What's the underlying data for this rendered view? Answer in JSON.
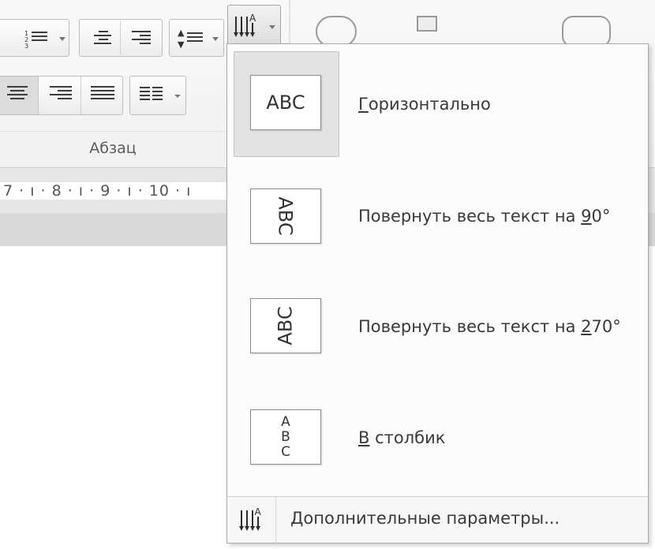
{
  "ribbon": {
    "group_label": "Абзац"
  },
  "ruler": {
    "text": "7 · ı · 8 · ı · 9 · ı · 10 · ı"
  },
  "menu": {
    "items": [
      {
        "label_underlined": "Г",
        "label_rest": "оризонтально",
        "thumb": "ABC",
        "selected": true
      },
      {
        "label_before": "Повернуть весь текст на ",
        "label_underlined": "9",
        "label_after": "0°",
        "thumb": "ABC"
      },
      {
        "label_before": "Повернуть весь текст на ",
        "label_underlined": "2",
        "label_after": "70°",
        "thumb": "ABC"
      },
      {
        "label_underlined": "В",
        "label_rest": " столбик",
        "thumb_letters": [
          "A",
          "B",
          "C"
        ]
      }
    ],
    "footer": {
      "label_underlined": "Д",
      "label_rest": "ополнительные параметры..."
    }
  },
  "icons": {
    "text_direction": "text-direction-icon",
    "numbered_list": "numbered-list-icon",
    "decrease_indent": "decrease-indent-icon",
    "increase_indent": "increase-indent-icon",
    "line_spacing": "line-spacing-icon",
    "align_center": "align-center-icon",
    "align_right": "align-right-icon",
    "justify": "justify-icon",
    "columns": "columns-icon"
  }
}
